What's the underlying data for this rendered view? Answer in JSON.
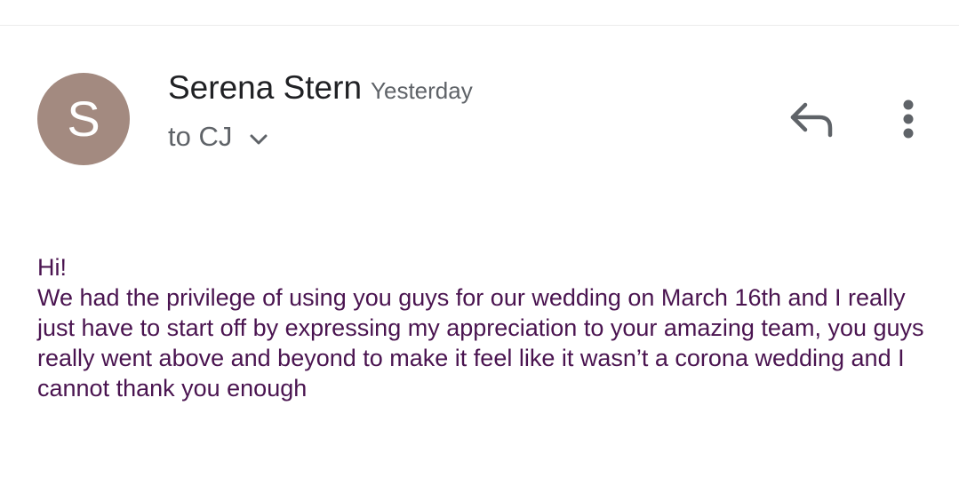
{
  "email": {
    "avatar_letter": "S",
    "sender_name": "Serena Stern",
    "timestamp": "Yesterday",
    "recipient": "to CJ",
    "greeting": "Hi!",
    "body": "We had the privilege of using you guys for our wedding on March 16th and I really just have to start off by expressing my appreciation to your amazing team, you guys really went above and beyond to make it feel like it wasn’t a corona wedding and I cannot thank you enough"
  },
  "icons": {
    "recipients_toggle": "chevron-down-icon",
    "reply": "reply-icon",
    "more": "more-vert-icon"
  },
  "colors": {
    "avatar_bg": "#a38a80",
    "body_text": "#4a1450",
    "sender_text": "#202124",
    "secondary_text": "#5f6368"
  }
}
